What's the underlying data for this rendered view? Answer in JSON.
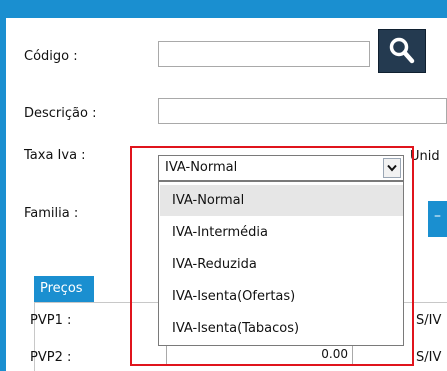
{
  "form": {
    "codigo_label": "Código :",
    "codigo_value": "",
    "descricao_label": "Descrição :",
    "descricao_value": "",
    "taxa_label": "Taxa Iva :",
    "familia_label": "Familia :",
    "unid_label": "Unid"
  },
  "taxa_iva": {
    "selected": "IVA-Normal",
    "options": [
      "IVA-Normal",
      "IVA-Intermédia",
      "IVA-Reduzida",
      "IVA-Isenta(Ofertas)",
      "IVA-Isenta(Tabacos)"
    ]
  },
  "precos": {
    "tab_label": "Preços",
    "pvp1_label": "PVP1 :",
    "pvp2_label": "PVP2 :",
    "pvp2_value": "0.00",
    "siva1": "S/IV",
    "siva2": "S/IV"
  },
  "colors": {
    "accent": "#1a8fd0",
    "highlight": "#e0141c",
    "search_button": "#243a50"
  }
}
